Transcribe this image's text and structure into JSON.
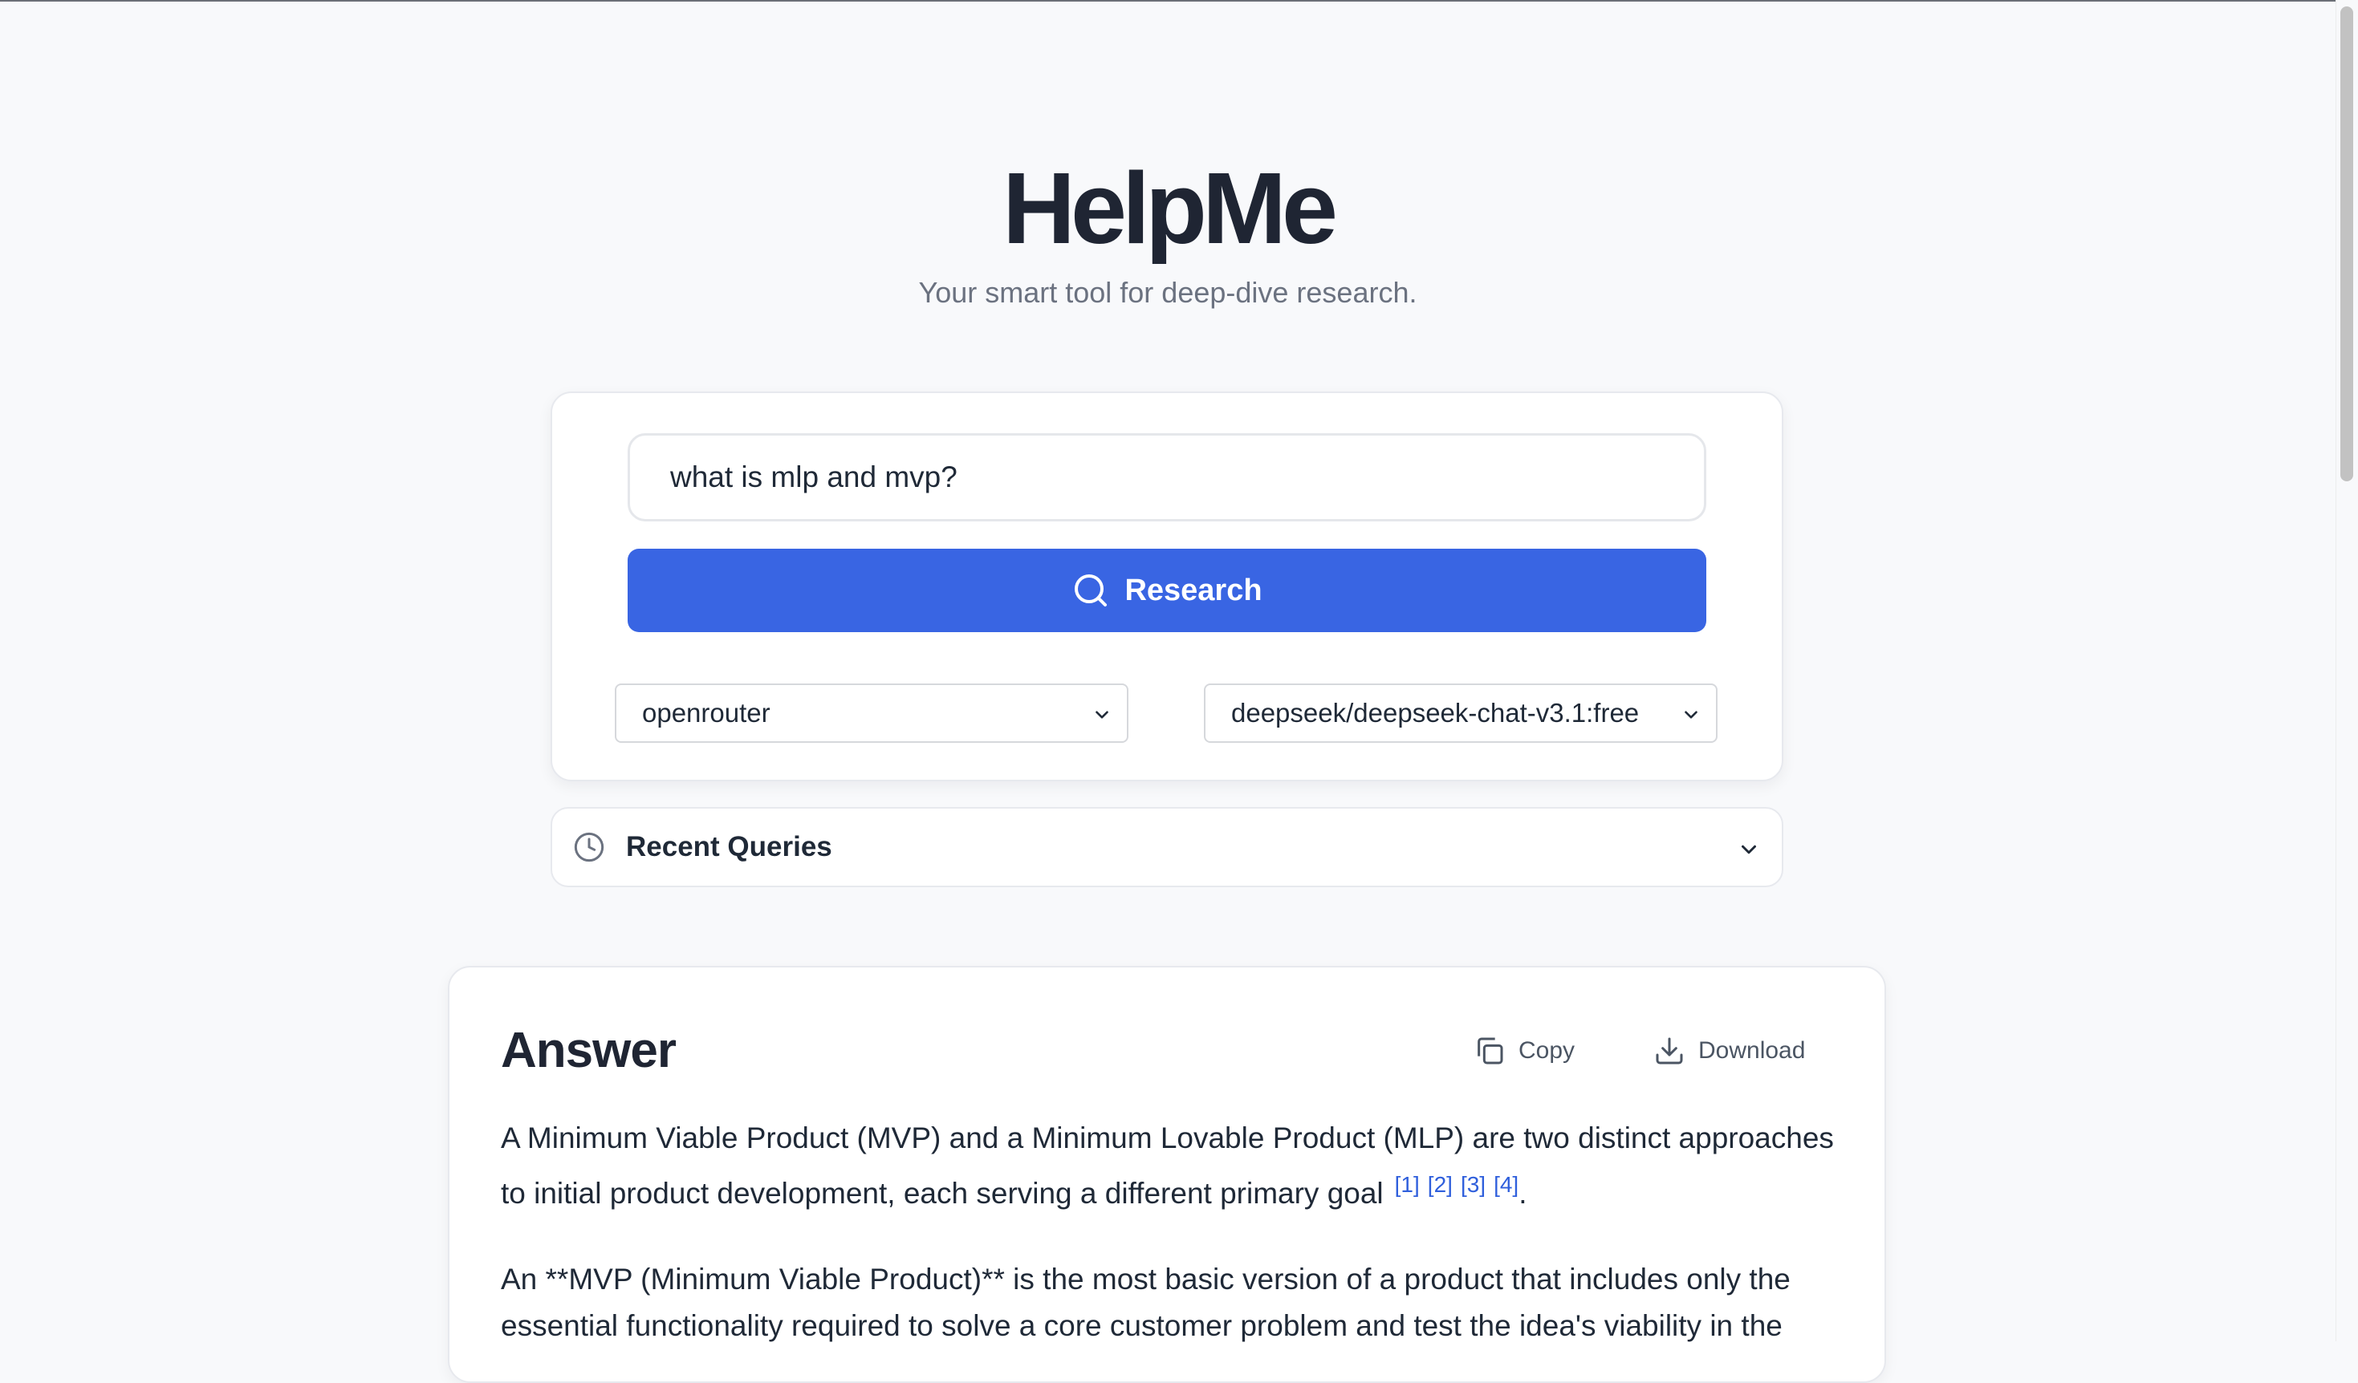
{
  "app": {
    "title": "HelpMe",
    "subtitle": "Your smart tool for deep-dive research."
  },
  "search": {
    "query_value": "what is mlp and mvp?",
    "button_label": "Research",
    "button_icon": "search-icon",
    "provider_selected": "openrouter",
    "model_selected": "deepseek/deepseek-chat-v3.1:free"
  },
  "recent_queries": {
    "label": "Recent Queries",
    "icon": "clock-icon"
  },
  "answer": {
    "title": "Answer",
    "copy_label": "Copy",
    "download_label": "Download",
    "paragraph_1_line_1": "A Minimum Viable Product (MVP) and a Minimum Lovable Product (MLP) are two distinct approaches",
    "paragraph_1_line_2": "to initial product development, each serving a different primary goal",
    "citations": [
      "[1]",
      "[2]",
      "[3]",
      "[4]"
    ],
    "paragraph_1_end": ".",
    "paragraph_2_line_1": "An **MVP (Minimum Viable Product)** is the most basic version of a product that includes only the",
    "paragraph_2_line_2": "essential functionality required to solve a core customer problem and test the idea's viability in the"
  },
  "colors": {
    "accent": "#3965e3",
    "citation": "#2f5fdc",
    "background": "#f8f9fb"
  }
}
